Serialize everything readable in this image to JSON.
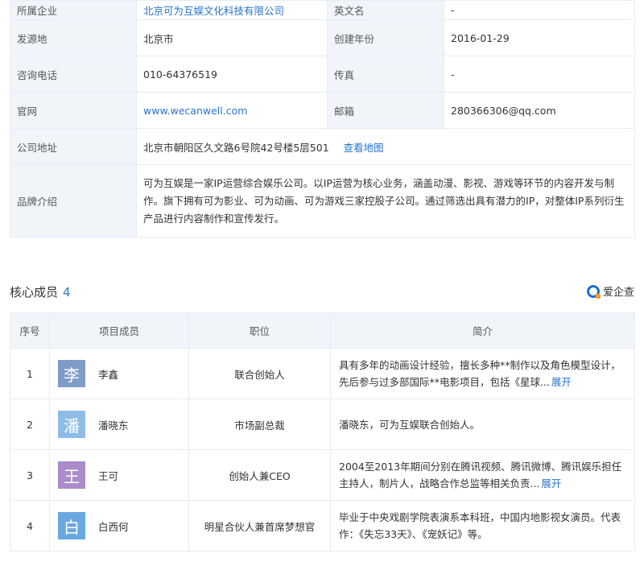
{
  "info": {
    "rows": [
      {
        "k1": "所属企业",
        "v1": "北京可为互娱文化科技有限公司",
        "k2": "英文名",
        "v2": "-"
      },
      {
        "k1": "发源地",
        "v1": "北京市",
        "k2": "创建年份",
        "v2": "2016-01-29"
      },
      {
        "k1": "咨询电话",
        "v1": "010-64376519",
        "k2": "传真",
        "v2": "-"
      },
      {
        "k1": "官网",
        "v1": "www.wecanwell.com",
        "k2": "邮箱",
        "v2": "280366306@qq.com"
      }
    ],
    "address_label": "公司地址",
    "address": "北京市朝阳区久文路6号院42号楼5层501",
    "map_button": "查看地图",
    "brand_label": "品牌介绍",
    "brand_desc": "可为互娱是一家IP运营综合娱乐公司。以IP运营为核心业务，涵盖动漫、影视、游戏等环节的内容开发与制作。旗下拥有可为影业、可为动画、可为游戏三家控股子公司。通过筛选出具有潜力的IP，对整体IP系列衍生产品进行内容制作和宣传发行。"
  },
  "members": {
    "title": "核心成员",
    "count": "4",
    "brand": "爱企查",
    "headers": {
      "idx": "序号",
      "member": "项目成员",
      "position": "职位",
      "intro": "简介"
    },
    "rows": [
      {
        "idx": "1",
        "avatar_char": "李",
        "avatar_color": "#7f9cc7",
        "name": "李鑫",
        "position": "联合创始人",
        "intro": "具有多年的动画设计经验，擅长多种**制作以及角色模型设计，先后参与过多部国际**电影项目，包括《星球...",
        "expand": "展开"
      },
      {
        "idx": "2",
        "avatar_char": "潘",
        "avatar_color": "#8fbce6",
        "name": "潘晓东",
        "position": "市场副总裁",
        "intro": "潘晓东，可为互娱联合创始人。",
        "expand": ""
      },
      {
        "idx": "3",
        "avatar_char": "王",
        "avatar_color": "#a98cc9",
        "name": "王可",
        "position": "创始人兼CEO",
        "intro": "2004至2013年期间分别在腾讯视频、腾讯微博、腾讯娱乐担任主持人，制片人，战略合作总监等相关负责...",
        "expand": "展开"
      },
      {
        "idx": "4",
        "avatar_char": "白",
        "avatar_color": "#6aa8e0",
        "name": "白西何",
        "position": "明星合伙人兼首席梦想官",
        "intro": "毕业于中央戏剧学院表演系本科班，中国内地影视女演员。代表作：《失忘33天》、《宠妖记》等。",
        "expand": ""
      }
    ]
  }
}
